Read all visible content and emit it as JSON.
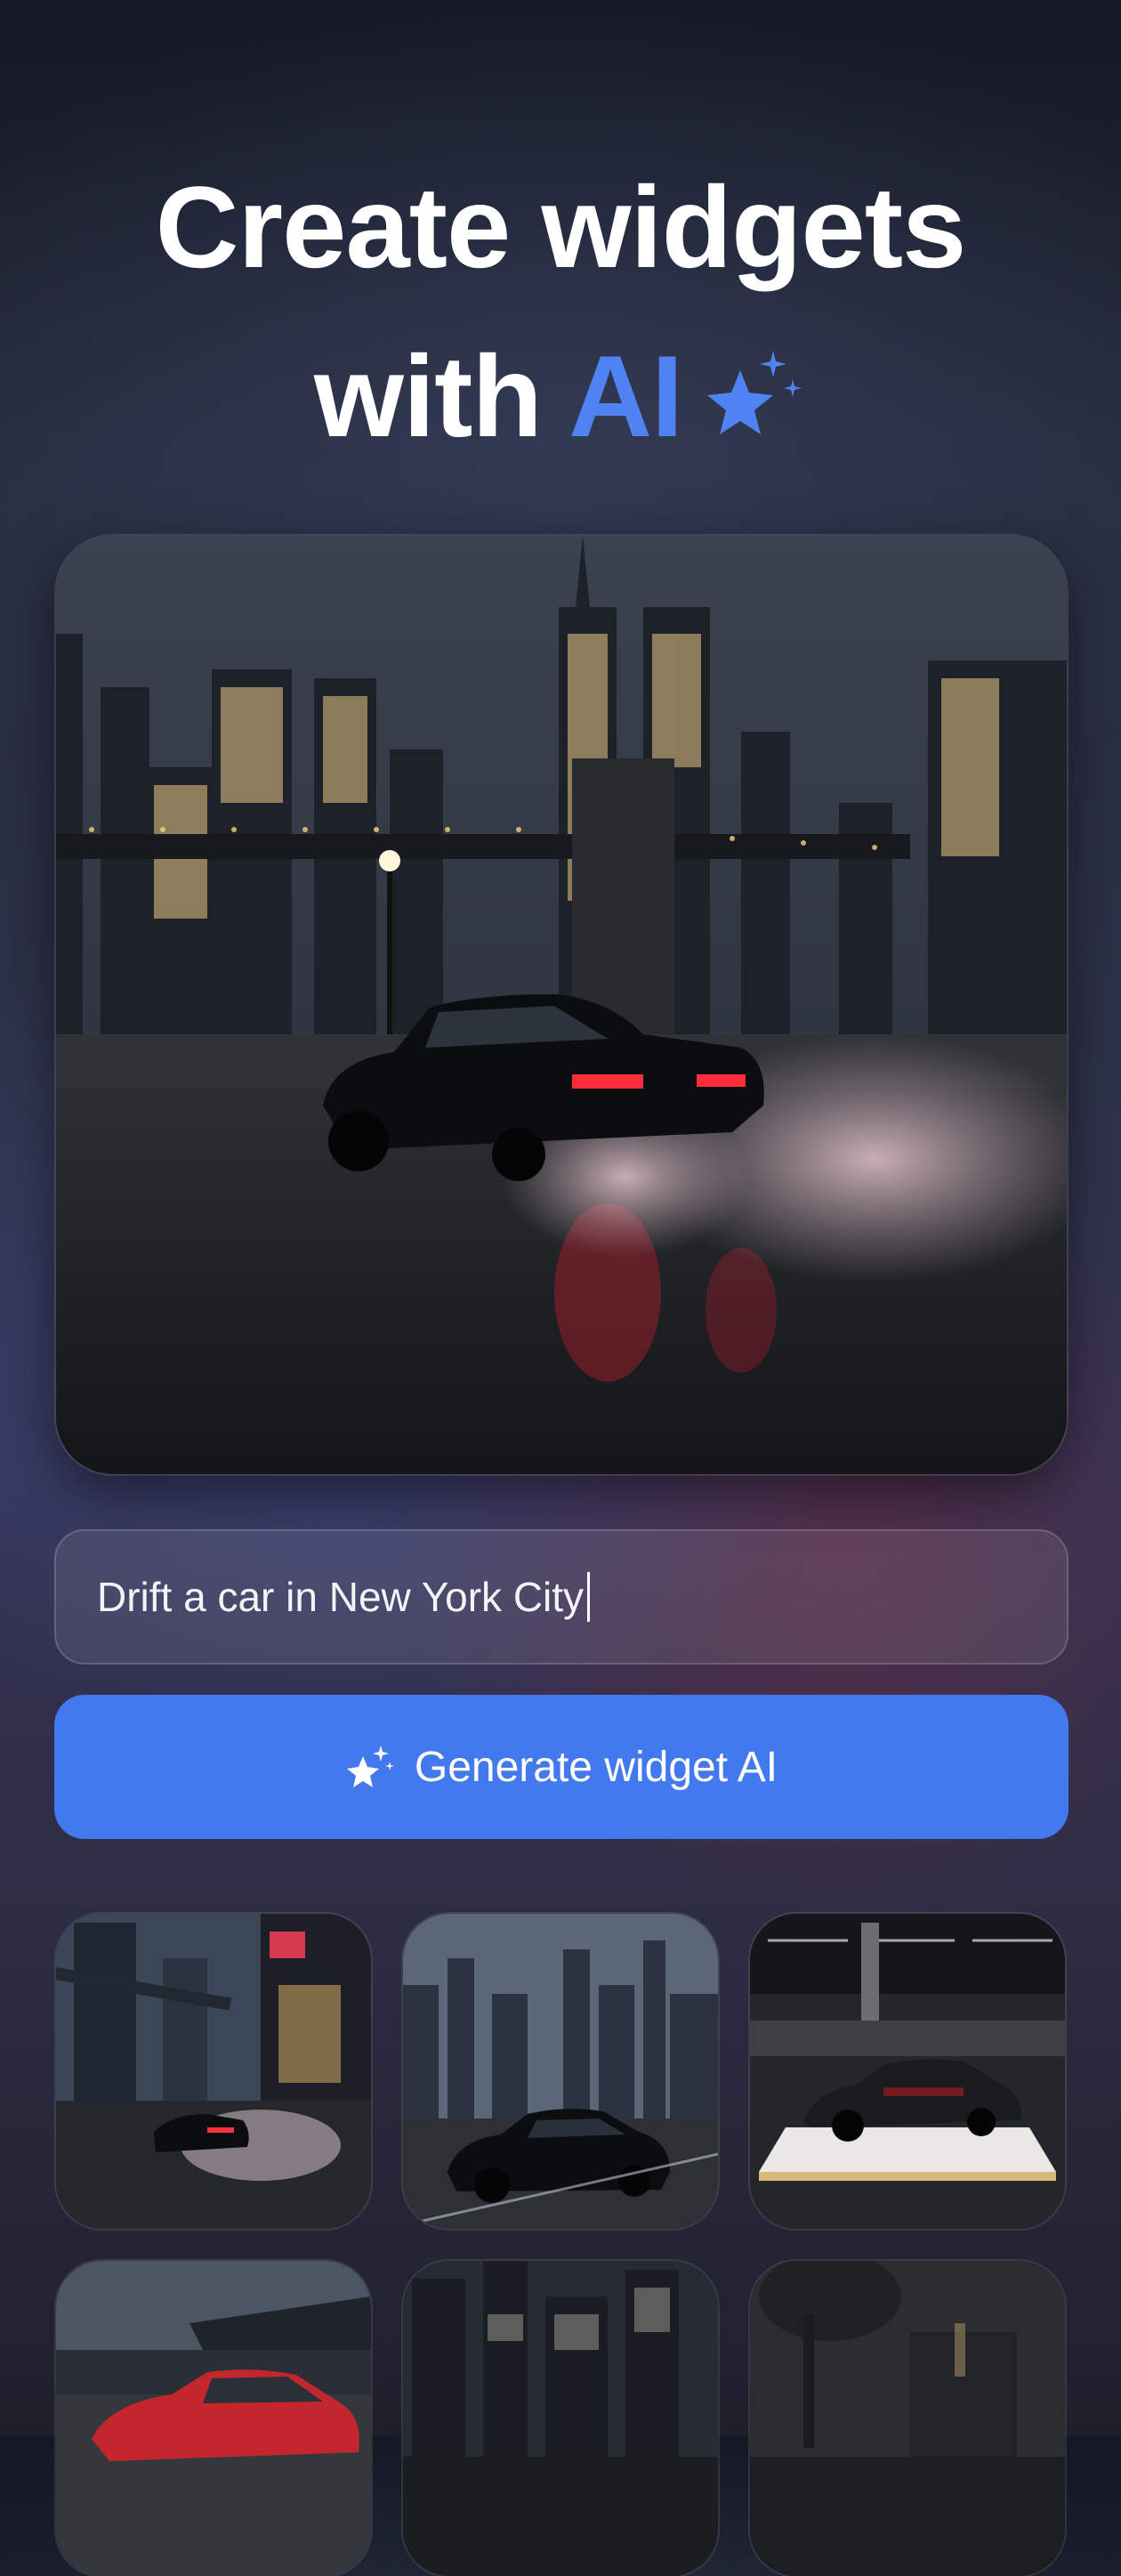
{
  "hero": {
    "title_line1": "Create widgets",
    "title_line2_prefix": "with",
    "title_line2_accent": "AI",
    "sparkle_icon": "sparkles-icon",
    "accent_color": "#4f82f3"
  },
  "preview": {
    "image": "night-city-car-drift-photo"
  },
  "prompt": {
    "value": "Drift a car in New York City"
  },
  "generate_button": {
    "label": "Generate widget AI",
    "icon": "sparkles-icon",
    "color": "#4279ee"
  },
  "gallery": {
    "items": [
      {
        "image": "city-street-drift-thumbnail"
      },
      {
        "image": "skyline-black-car-thumbnail"
      },
      {
        "image": "showroom-car-thumbnail"
      },
      {
        "image": "race-track-red-car-thumbnail"
      },
      {
        "image": "dark-city-night-thumbnail"
      },
      {
        "image": "dark-plaza-thumbnail"
      }
    ]
  }
}
